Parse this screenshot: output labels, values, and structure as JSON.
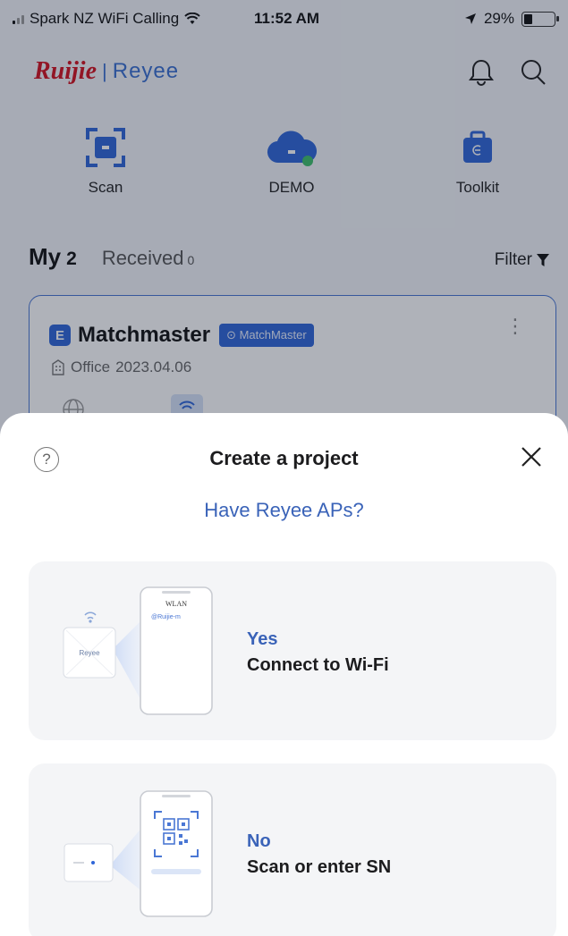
{
  "status_bar": {
    "carrier": "Spark NZ WiFi Calling",
    "time": "11:52 AM",
    "battery": "29%",
    "battery_level": 0.29
  },
  "header": {
    "logo_brand": "Ruijie",
    "logo_separator": "|",
    "logo_product": "Reyee",
    "icons": [
      "bell-icon",
      "search-icon"
    ]
  },
  "quick_actions": [
    {
      "label": "Scan",
      "icon": "scan-icon"
    },
    {
      "label": "DEMO",
      "icon": "cloud-icon"
    },
    {
      "label": "Toolkit",
      "icon": "toolkit-icon"
    }
  ],
  "tabs": {
    "my_label": "My",
    "my_count": "2",
    "received_label": "Received",
    "received_count": "0",
    "filter_label": "Filter"
  },
  "project_card": {
    "badge": "E",
    "name": "Matchmaster",
    "tag": "MatchMaster",
    "type": "Office",
    "date": "2023.04.06"
  },
  "sheet": {
    "title": "Create a project",
    "subtitle": "Have Reyee APs?",
    "help_glyph": "?",
    "options": [
      {
        "answer": "Yes",
        "description": "Connect to Wi-Fi",
        "illus_header": "WLAN",
        "illus_network": "@Ruijie-m",
        "illus_device": "Reyee"
      },
      {
        "answer": "No",
        "description": "Scan or enter SN"
      }
    ]
  },
  "colors": {
    "brand_red": "#d4121f",
    "accent_blue": "#3a63b8",
    "primary_blue": "#2f66d8",
    "card_bg": "#f4f5f7"
  }
}
